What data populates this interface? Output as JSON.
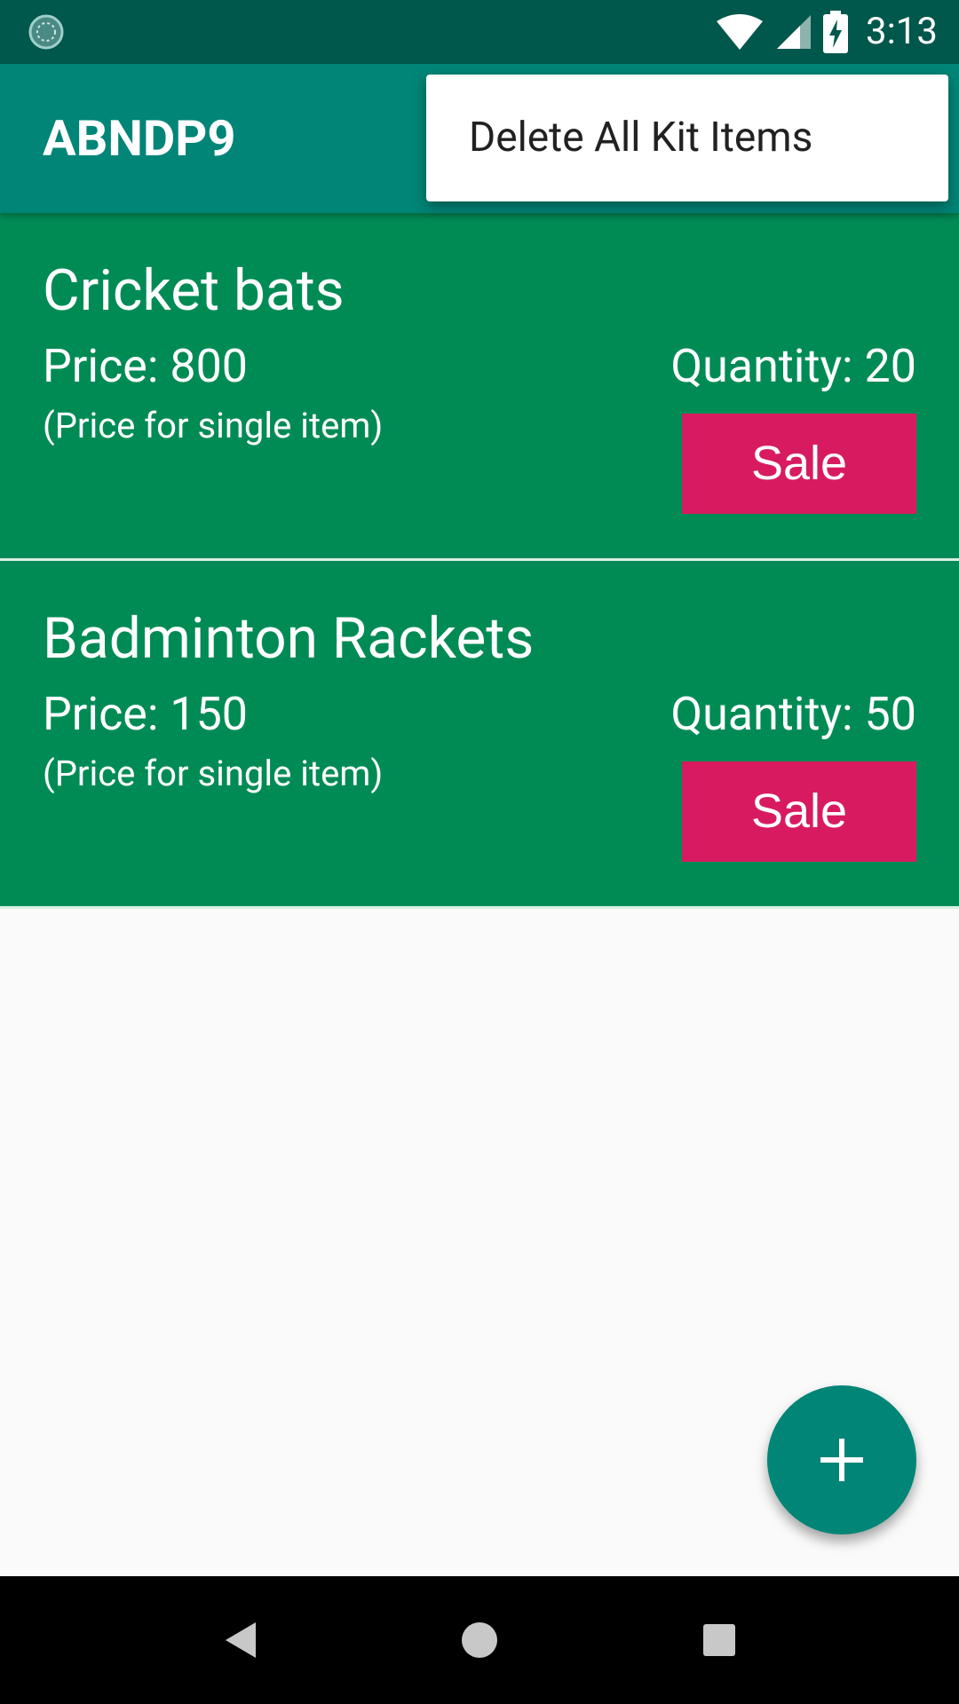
{
  "status_bar": {
    "time": "3:13",
    "left_icon": "loading-circle-icon",
    "wifi_icon": "wifi-icon",
    "signal_icon": "signal-icon",
    "battery_icon": "battery-charging-icon"
  },
  "app_bar": {
    "title": "ABNDP9"
  },
  "overflow_menu": {
    "items": [
      "Delete All Kit Items"
    ]
  },
  "products": [
    {
      "name": "Cricket bats",
      "price": "Price: 800",
      "price_note": "(Price for single item)",
      "quantity": "Quantity: 20",
      "sale_label": "Sale"
    },
    {
      "name": "Badminton Rackets",
      "price": "Price: 150",
      "price_note": "(Price for single item)",
      "quantity": "Quantity: 50",
      "sale_label": "Sale"
    }
  ],
  "fab": {
    "icon": "plus-icon"
  },
  "nav_bar": {
    "back_icon": "back-icon",
    "home_icon": "home-icon",
    "recents_icon": "recents-icon"
  },
  "colors": {
    "status_bar": "#00574b",
    "primary": "#008577",
    "card": "#008b55",
    "accent": "#d81b60",
    "background": "#fafafa"
  }
}
